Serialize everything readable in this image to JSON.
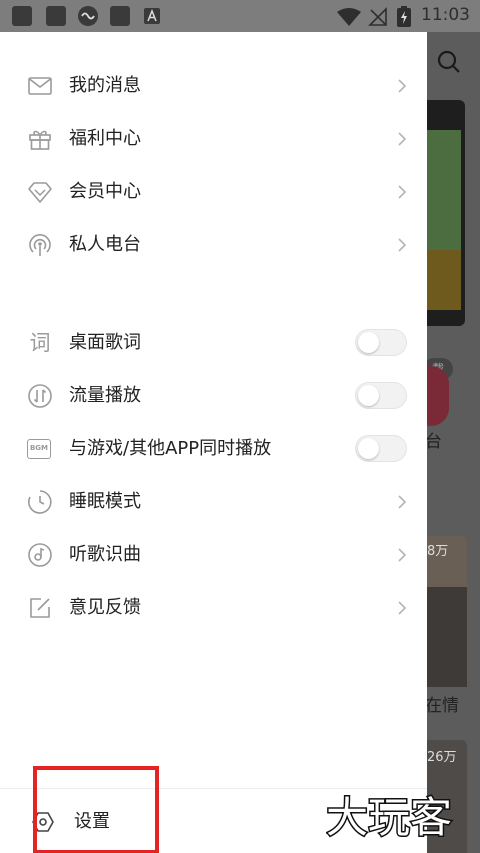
{
  "status_bar": {
    "time": "11:03"
  },
  "background_app": {
    "pill_text": "载",
    "label_1": "台",
    "badge_1": "8万",
    "label_2": "在情",
    "badge_2": "26万"
  },
  "menu": {
    "group1": [
      {
        "label": "我的消息",
        "icon": "mail-icon"
      },
      {
        "label": "福利中心",
        "icon": "gift-icon"
      },
      {
        "label": "会员中心",
        "icon": "diamond-icon"
      },
      {
        "label": "私人电台",
        "icon": "radio-icon"
      }
    ],
    "group2": [
      {
        "label": "桌面歌词",
        "icon": "lyrics-icon",
        "control": "toggle",
        "on": false
      },
      {
        "label": "流量播放",
        "icon": "data-traffic-icon",
        "control": "toggle",
        "on": false
      },
      {
        "label": "与游戏/其他APP同时播放",
        "icon": "bgm-icon",
        "icon_text": "BGM",
        "control": "toggle",
        "on": false
      },
      {
        "label": "睡眠模式",
        "icon": "sleep-timer-icon"
      },
      {
        "label": "听歌识曲",
        "icon": "music-recognition-icon"
      },
      {
        "label": "意见反馈",
        "icon": "feedback-icon"
      }
    ],
    "lyrics_glyph": "词"
  },
  "bottom": {
    "settings_label": "设置"
  },
  "watermark": {
    "text": "大玩客"
  },
  "colors": {
    "highlight": "#e52323",
    "icon": "#9a9a9a"
  }
}
